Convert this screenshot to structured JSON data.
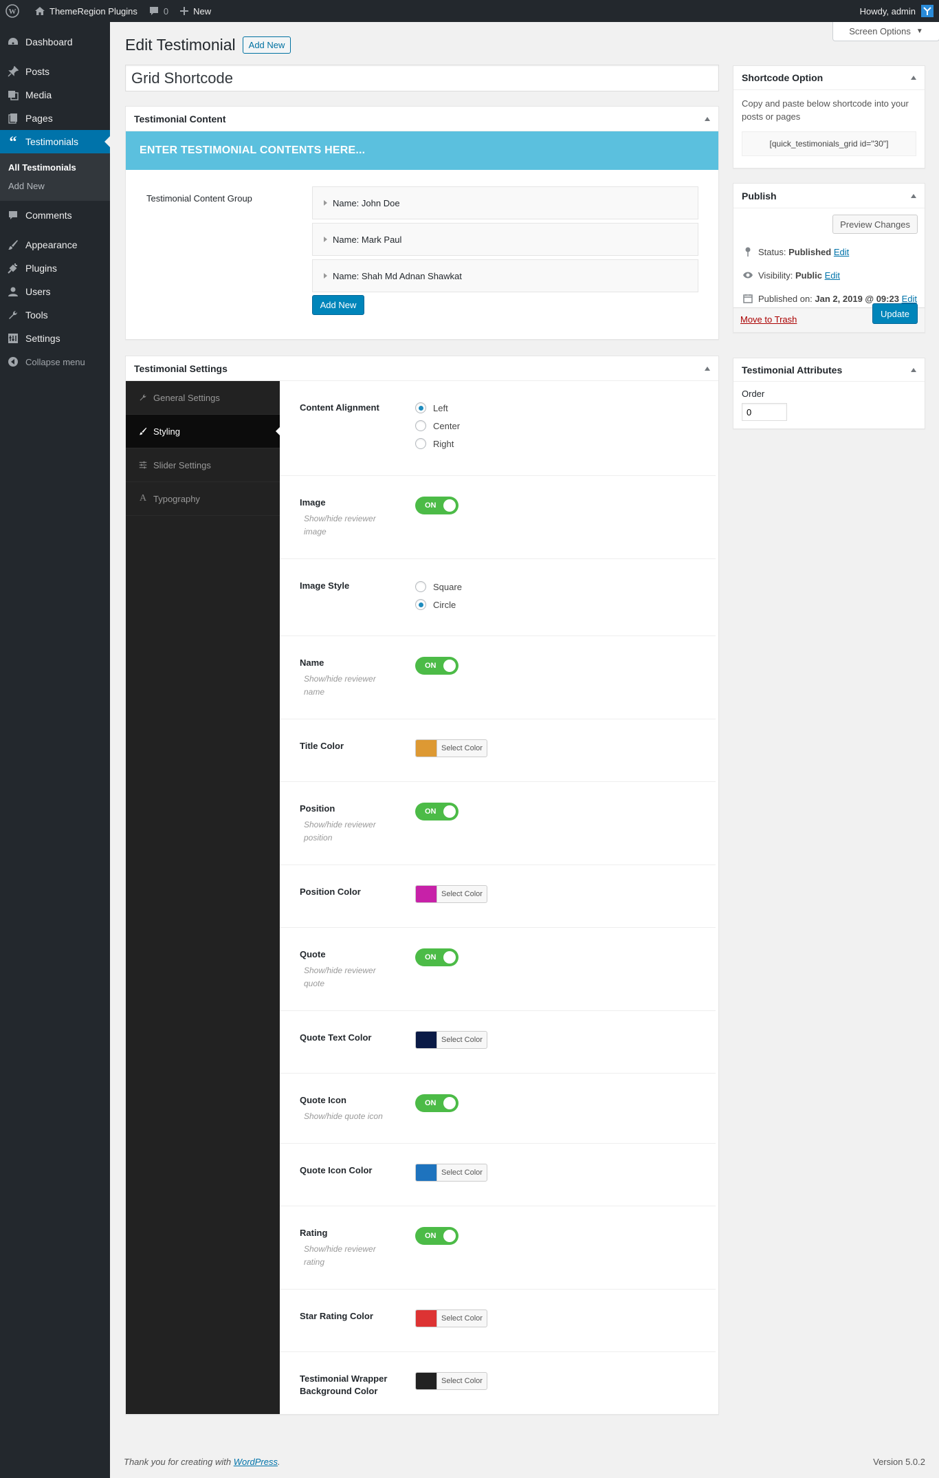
{
  "adminbar": {
    "site_name": "ThemeRegion Plugins",
    "comments_count": "0",
    "new_label": "New",
    "howdy": "Howdy, admin"
  },
  "sidebar": {
    "items": [
      {
        "label": "Dashboard",
        "icon": "dashboard-icon"
      },
      {
        "label": "Posts",
        "icon": "pin-icon"
      },
      {
        "label": "Media",
        "icon": "media-icon"
      },
      {
        "label": "Pages",
        "icon": "pages-icon"
      },
      {
        "label": "Testimonials",
        "icon": "quote-icon"
      },
      {
        "label": "Comments",
        "icon": "comment-icon"
      },
      {
        "label": "Appearance",
        "icon": "brush-icon"
      },
      {
        "label": "Plugins",
        "icon": "plug-icon"
      },
      {
        "label": "Users",
        "icon": "user-icon"
      },
      {
        "label": "Tools",
        "icon": "wrench-icon"
      },
      {
        "label": "Settings",
        "icon": "settings-icon"
      },
      {
        "label": "Collapse menu",
        "icon": "collapse-icon"
      }
    ],
    "submenu": [
      "All Testimonials",
      "Add New"
    ]
  },
  "header": {
    "title": "Edit Testimonial",
    "add_new": "Add New",
    "screen_options": "Screen Options"
  },
  "post_title": "Grid Shortcode",
  "content_box": {
    "title": "Testimonial Content",
    "banner": "ENTER TESTIMONIAL CONTENTS HERE...",
    "group_label": "Testimonial Content Group",
    "items": [
      "Name: John Doe",
      "Name: Mark Paul",
      "Name: Shah Md Adnan Shawkat"
    ],
    "add_new": "Add New"
  },
  "settings_box": {
    "title": "Testimonial Settings",
    "nav": [
      {
        "label": "General Settings",
        "icon": "wrench-icon"
      },
      {
        "label": "Styling",
        "icon": "brush-icon"
      },
      {
        "label": "Slider Settings",
        "icon": "sliders-icon"
      },
      {
        "label": "Typography",
        "icon": "typography-icon"
      }
    ],
    "alignment": {
      "label": "Content Alignment",
      "options": [
        "Left",
        "Center",
        "Right"
      ],
      "selected": "Left"
    },
    "image": {
      "label": "Image",
      "desc": "Show/hide reviewer image",
      "state": "ON"
    },
    "image_style": {
      "label": "Image Style",
      "options": [
        "Square",
        "Circle"
      ],
      "selected": "Circle"
    },
    "name": {
      "label": "Name",
      "desc": "Show/hide reviewer name",
      "state": "ON"
    },
    "title_color": {
      "label": "Title Color",
      "color": "#dd9933",
      "button": "Select Color"
    },
    "position": {
      "label": "Position",
      "desc": "Show/hide reviewer position",
      "state": "ON"
    },
    "position_color": {
      "label": "Position Color",
      "color": "#c721a8",
      "button": "Select Color"
    },
    "quote": {
      "label": "Quote",
      "desc": "Show/hide reviewer quote",
      "state": "ON"
    },
    "quote_text_color": {
      "label": "Quote Text Color",
      "color": "#0a1a46",
      "button": "Select Color"
    },
    "quote_icon": {
      "label": "Quote Icon",
      "desc": "Show/hide quote icon",
      "state": "ON"
    },
    "quote_icon_color": {
      "label": "Quote Icon Color",
      "color": "#1e73be",
      "button": "Select Color"
    },
    "rating": {
      "label": "Rating",
      "desc": "Show/hide reviewer rating",
      "state": "ON"
    },
    "star_rating_color": {
      "label": "Star Rating Color",
      "color": "#dd3333",
      "button": "Select Color"
    },
    "wrapper_bg": {
      "label": "Testimonial Wrapper Background Color",
      "color": "#222222",
      "button": "Select Color"
    }
  },
  "shortcode_box": {
    "title": "Shortcode Option",
    "text": "Copy and paste below shortcode into your posts or pages",
    "shortcode": "[quick_testimonials_grid id=\"30\"]"
  },
  "publish_box": {
    "title": "Publish",
    "preview": "Preview Changes",
    "status_label": "Status:",
    "status_value": "Published",
    "visibility_label": "Visibility:",
    "visibility_value": "Public",
    "published_label": "Published on:",
    "published_value": "Jan 2, 2019 @ 09:23",
    "edit": "Edit",
    "trash": "Move to Trash",
    "update": "Update"
  },
  "attributes_box": {
    "title": "Testimonial Attributes",
    "order_label": "Order",
    "order_value": "0"
  },
  "footer": {
    "thanks": "Thank you for creating with",
    "wp_link": "WordPress",
    "period": ".",
    "version": "Version 5.0.2"
  },
  "colors": {
    "accent": "#0073aa",
    "banner": "#5bc0de",
    "toggle_on": "#4cbb47"
  }
}
